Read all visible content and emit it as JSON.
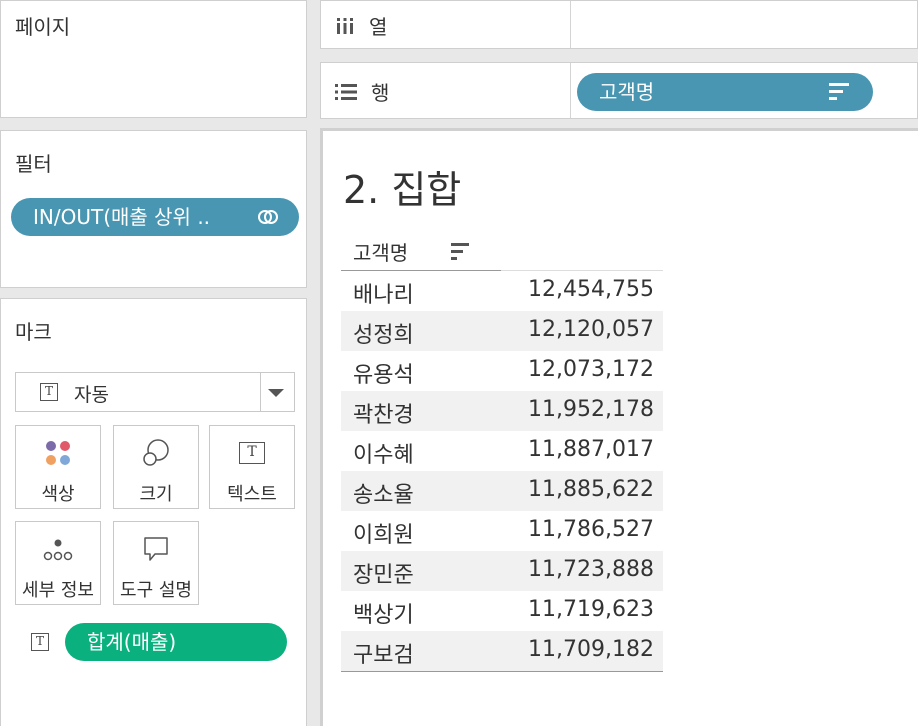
{
  "pages": {
    "title": "페이지"
  },
  "filters": {
    "title": "필터",
    "pill_label": "IN/OUT(매출 상위 .."
  },
  "marks": {
    "title": "마크",
    "mark_type": "자동",
    "buttons": {
      "color": "색상",
      "size": "크기",
      "text": "텍스트",
      "detail": "세부 정보",
      "tooltip": "도구 설명"
    },
    "text_pill": "합계(매출)"
  },
  "shelves": {
    "columns_label": "열",
    "rows_label": "행",
    "rows_pill": "고객명"
  },
  "view": {
    "title": "2. 집합",
    "column_header": "고객명",
    "rows": [
      {
        "name": "배나리",
        "value": "12,454,755"
      },
      {
        "name": "성정희",
        "value": "12,120,057"
      },
      {
        "name": "유용석",
        "value": "12,073,172"
      },
      {
        "name": "곽찬경",
        "value": "11,952,178"
      },
      {
        "name": "이수혜",
        "value": "11,887,017"
      },
      {
        "name": "송소율",
        "value": "11,885,622"
      },
      {
        "name": "이희원",
        "value": "11,786,527"
      },
      {
        "name": "장민준",
        "value": "11,723,888"
      },
      {
        "name": "백상기",
        "value": "11,719,623"
      },
      {
        "name": "구보검",
        "value": "11,709,182"
      }
    ]
  },
  "colors": {
    "dimension_pill": "#4996b2",
    "measure_pill": "#0bb07f"
  }
}
